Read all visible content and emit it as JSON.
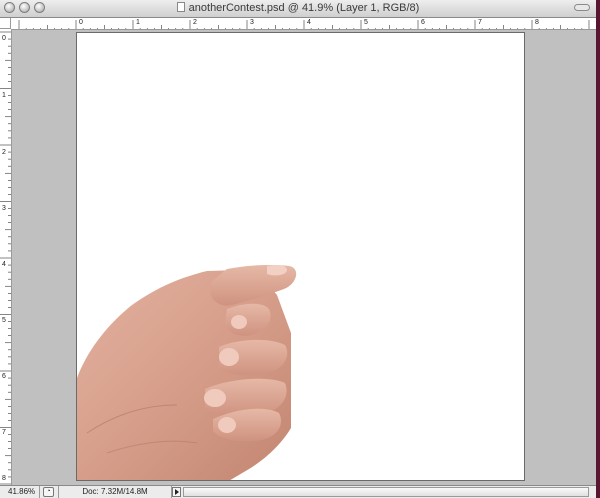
{
  "window": {
    "title": "anotherContest.psd @ 41.9% (Layer 1, RGB/8)"
  },
  "rulers": {
    "horizontal": [
      "0",
      "1",
      "2",
      "3",
      "4",
      "5",
      "6",
      "7",
      "8"
    ],
    "vertical": [
      "0",
      "1",
      "2",
      "3",
      "4",
      "5",
      "6",
      "7",
      "8"
    ]
  },
  "canvas": {
    "background": "#ffffff",
    "content": "hand-fist-image"
  },
  "status": {
    "zoom": "41.86%",
    "doc_info": "Doc: 7.32M/14.8M"
  },
  "colors": {
    "desktop": "#5a1530",
    "pasteboard": "#c0c0c0",
    "skin": "#d9a390"
  }
}
